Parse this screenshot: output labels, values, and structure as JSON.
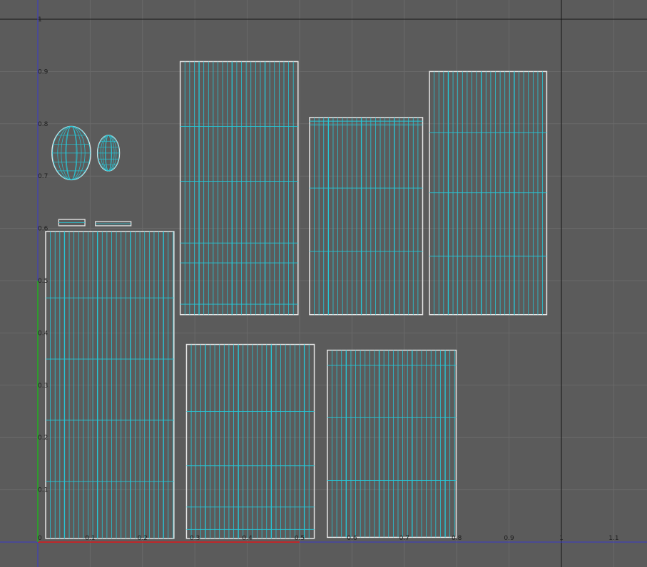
{
  "viewport": {
    "background": "#5b5b5b",
    "grid_color": "#6a6a6a",
    "axis_color": "#141414",
    "u_axis_color": "#c0282a",
    "v_axis_color": "#2e9b2e",
    "uv_line_color": "#26c6d6",
    "shell_border_color": "#e6e6e6"
  },
  "axes": {
    "u_ticks": [
      "0",
      "0.1",
      "0.2",
      "0.3",
      "0.4",
      "0.5",
      "0.6",
      "0.7",
      "0.8",
      "0.9",
      "1",
      "1.1"
    ],
    "v_ticks": [
      "1",
      "0.9",
      "0.8",
      "0.7",
      "0.6",
      "0.5",
      "0.4",
      "0.3",
      "0.2",
      "0.1"
    ]
  },
  "uv_shells": [
    {
      "name": "uv-shell-1",
      "u": [
        0.015,
        0.26
      ],
      "v": [
        0.007,
        0.594
      ],
      "col_step": 0.009,
      "rows": [
        0.116,
        0.233,
        0.35,
        0.467
      ]
    },
    {
      "name": "uv-shell-2",
      "u": [
        0.272,
        0.497
      ],
      "v": [
        0.435,
        0.919
      ],
      "col_step": 0.009,
      "rows": [
        0.455,
        0.534,
        0.572,
        0.69,
        0.795
      ]
    },
    {
      "name": "uv-shell-3",
      "u": [
        0.519,
        0.735
      ],
      "v": [
        0.435,
        0.812
      ],
      "col_step": 0.009,
      "rows": [
        0.556,
        0.677,
        0.798,
        0.805
      ]
    },
    {
      "name": "uv-shell-4",
      "u": [
        0.748,
        0.972
      ],
      "v": [
        0.435,
        0.9
      ],
      "col_step": 0.009,
      "rows": [
        0.547,
        0.668,
        0.783
      ]
    },
    {
      "name": "uv-shell-5",
      "u": [
        0.284,
        0.528
      ],
      "v": [
        0.007,
        0.378
      ],
      "col_step": 0.009,
      "rows": [
        0.024,
        0.067,
        0.146,
        0.25
      ]
    },
    {
      "name": "uv-shell-6",
      "u": [
        0.553,
        0.799
      ],
      "v": [
        0.009,
        0.367
      ],
      "col_step": 0.009,
      "rows": [
        0.118,
        0.238,
        0.338
      ]
    }
  ],
  "small_shells": [
    {
      "name": "uv-shell-ellipse-large",
      "cu": 0.064,
      "cv": 0.744,
      "ru": 0.037,
      "rv": 0.051
    },
    {
      "name": "uv-shell-ellipse-small",
      "cu": 0.135,
      "cv": 0.744,
      "ru": 0.021,
      "rv": 0.034
    },
    {
      "name": "uv-shell-strip-1",
      "u": [
        0.04,
        0.09
      ],
      "v": [
        0.605,
        0.617
      ]
    },
    {
      "name": "uv-shell-strip-2",
      "u": [
        0.11,
        0.178
      ],
      "v": [
        0.605,
        0.613
      ]
    }
  ]
}
